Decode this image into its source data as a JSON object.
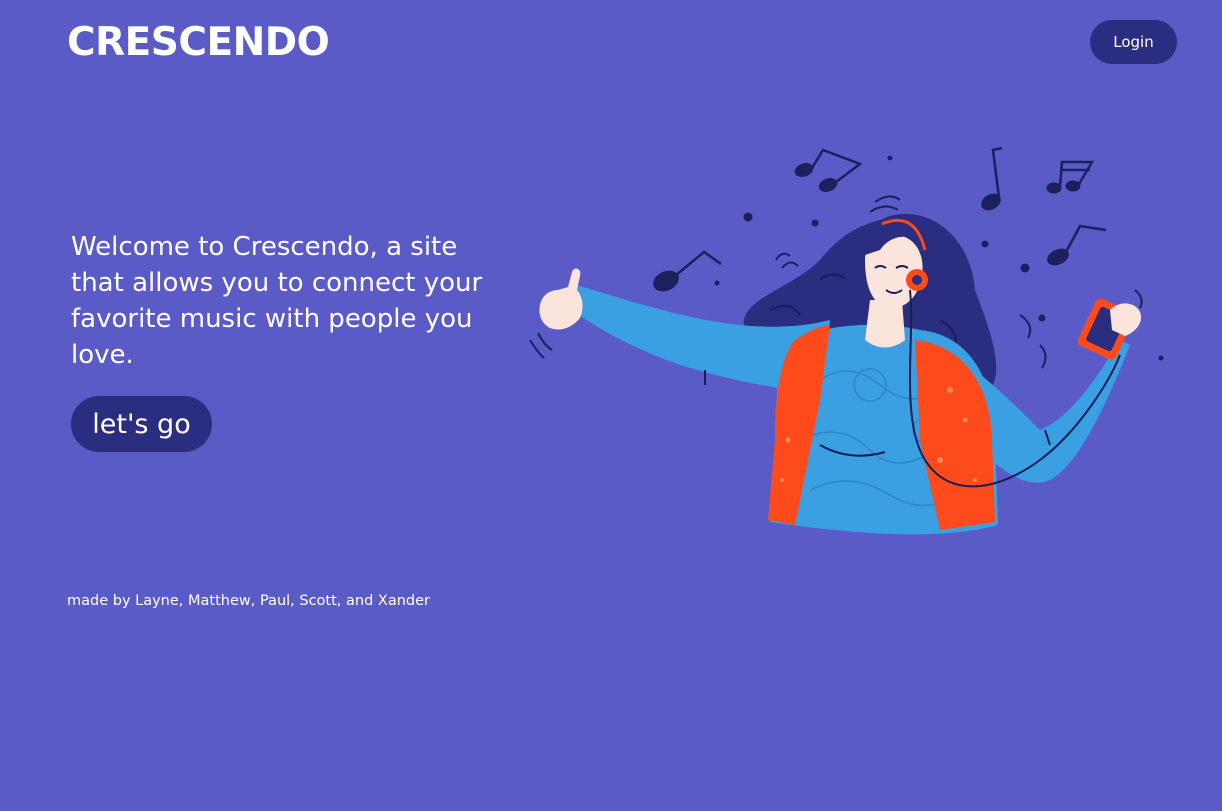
{
  "header": {
    "logo": "CRESCENDO",
    "login_label": "Login"
  },
  "hero": {
    "welcome_text": "Welcome to Crescendo, a site that allows you to connect your favorite music with people you love.",
    "cta_label": "let's go",
    "illustration_alt": "Woman with headphones dancing to music"
  },
  "footer": {
    "credits": "made by Layne, Matthew, Paul, Scott, and Xander"
  },
  "colors": {
    "background": "#5b5bc8",
    "button": "#2b2d80",
    "text": "#ffffff",
    "accent_orange": "#ff4a1c",
    "sweater_blue": "#3aa0e2",
    "hair_navy": "#2b2d80"
  }
}
